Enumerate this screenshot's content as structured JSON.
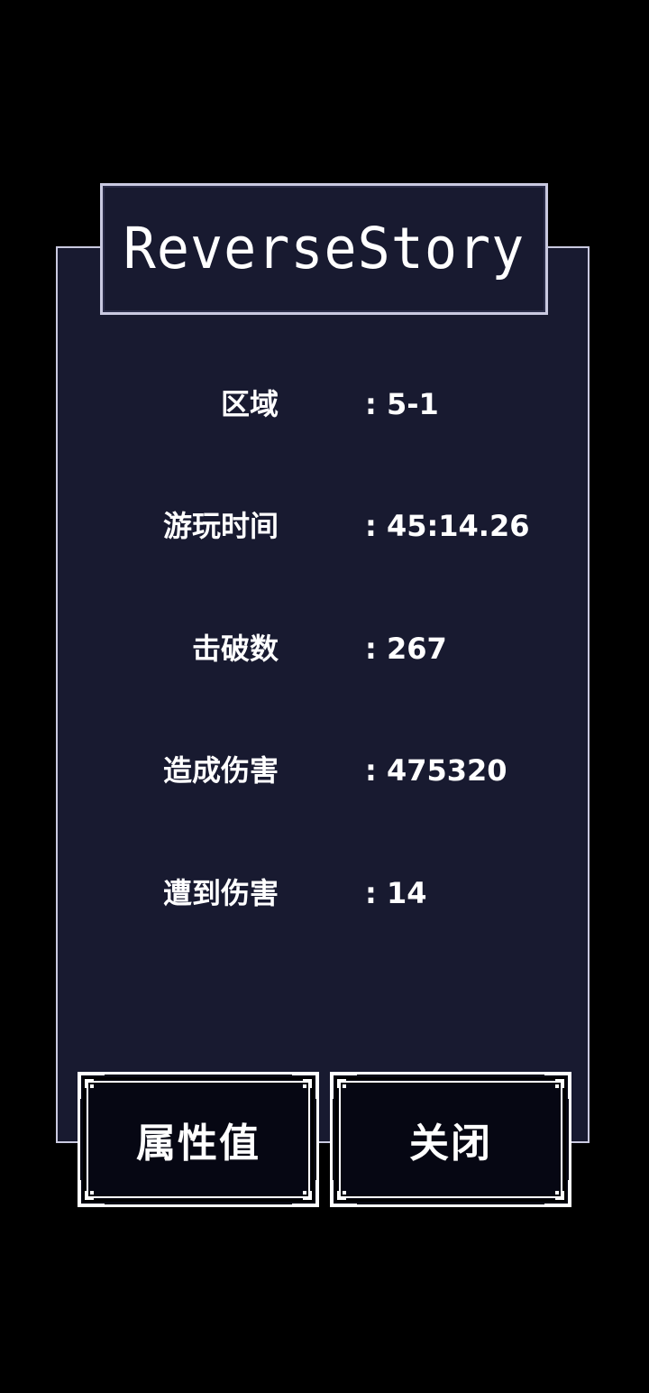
{
  "title": "ReverseStory",
  "stats": [
    {
      "label": "区域",
      "value": ": 5-1"
    },
    {
      "label": "游玩时间",
      "value": ": 45:14.26"
    },
    {
      "label": "击破数",
      "value": ": 267"
    },
    {
      "label": "造成伤害",
      "value": ": 475320"
    },
    {
      "label": "遭到伤害",
      "value": ": 14"
    }
  ],
  "buttons": {
    "attributes_label": "属性值",
    "close_label": "关闭"
  },
  "colors": {
    "background": "#000000",
    "panel": "#181a30",
    "panel_border": "#c9c9e0",
    "button_fill": "#060713",
    "text": "#ffffff"
  }
}
